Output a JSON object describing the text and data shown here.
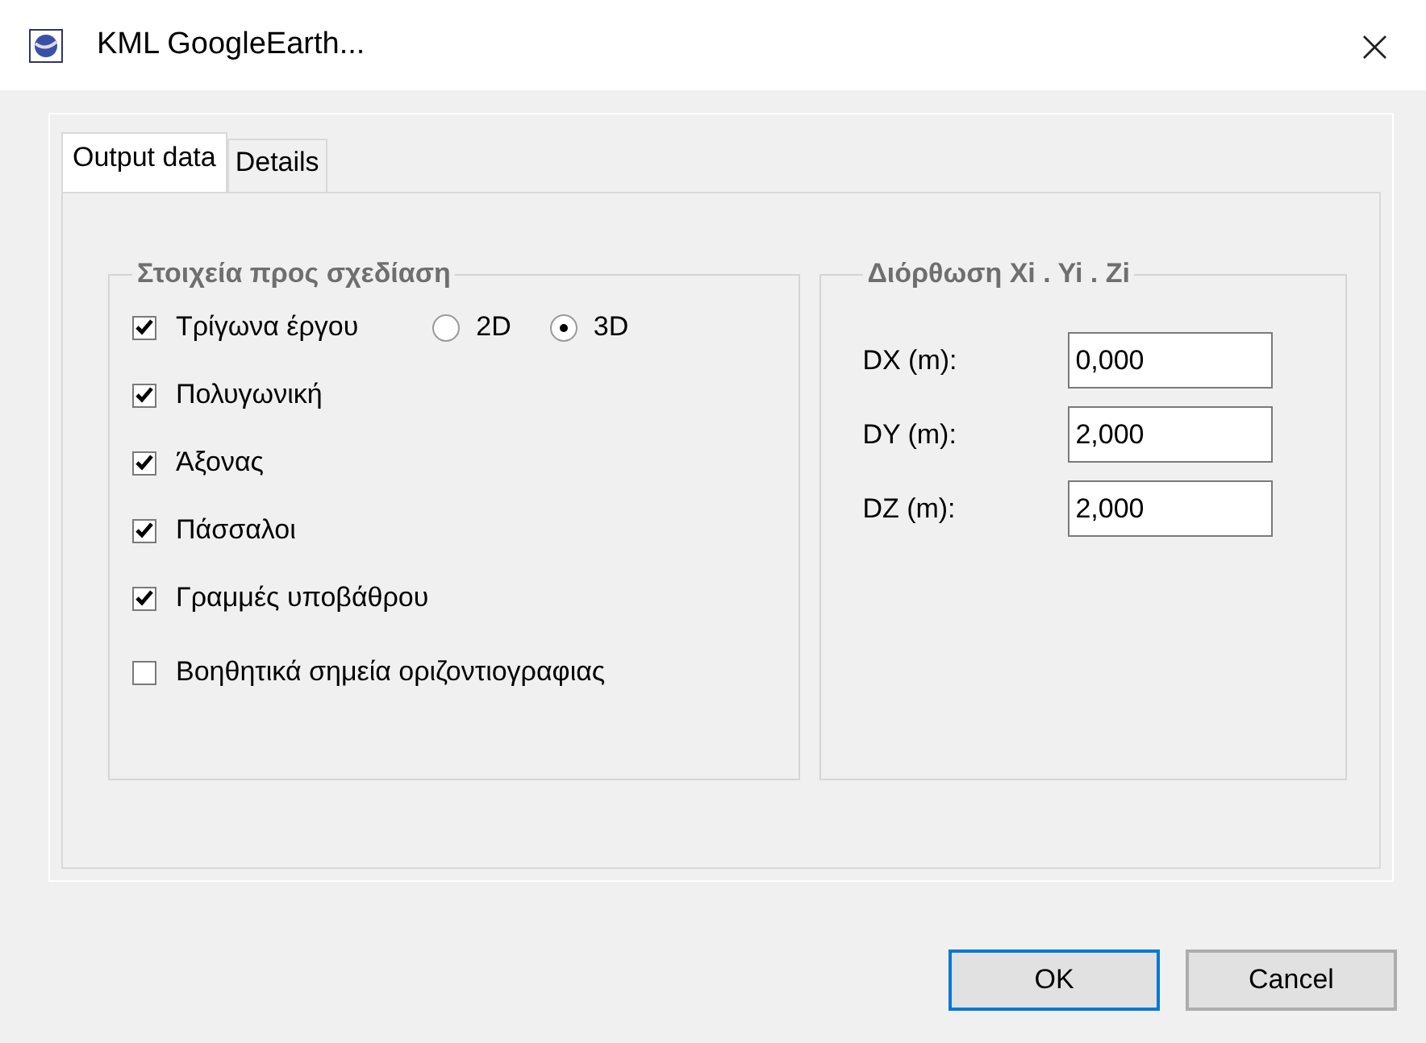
{
  "window": {
    "title": "KML GoogleEarth...",
    "close": "×"
  },
  "tabs": [
    {
      "label": "Output data",
      "selected": true
    },
    {
      "label": "Details",
      "selected": false
    }
  ],
  "group_elements": {
    "title": "Στοιχεία προς σχεδίαση",
    "items": [
      {
        "label": "Τρίγωνα έργου",
        "checked": true
      },
      {
        "label": "Πολυγωνική",
        "checked": true
      },
      {
        "label": "Άξονας",
        "checked": true
      },
      {
        "label": "Πάσσαλοι",
        "checked": true
      },
      {
        "label": "Γραμμές υποβάθρου",
        "checked": true
      },
      {
        "label": "Βοηθητικά σημεία οριζοντιογραφιας",
        "checked": false
      }
    ],
    "mode": [
      {
        "label": "2D",
        "selected": false
      },
      {
        "label": "3D",
        "selected": true
      }
    ]
  },
  "group_offset": {
    "title": "Διόρθωση Xi . Yi . Zi",
    "fields": [
      {
        "label": "DX (m):",
        "value": "0,000"
      },
      {
        "label": "DY (m):",
        "value": "2,000"
      },
      {
        "label": "DZ (m):",
        "value": "2,000"
      }
    ]
  },
  "buttons": [
    {
      "label": "OK",
      "default": true
    },
    {
      "label": "Cancel",
      "default": false
    }
  ]
}
